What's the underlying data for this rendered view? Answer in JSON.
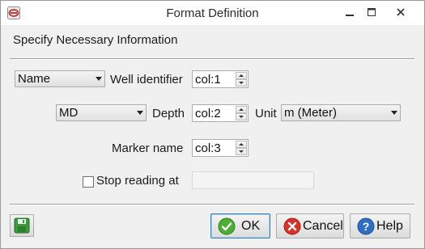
{
  "window": {
    "title": "Format Definition",
    "controls": [
      "minimize-icon",
      "maximize-icon",
      "close-icon"
    ]
  },
  "main": {
    "heading": "Specify Necessary Information",
    "well_identifier": {
      "combo_value": "Name",
      "label": "Well identifier",
      "column_value": "col:1"
    },
    "depth": {
      "combo_value": "MD",
      "label": "Depth",
      "column_value": "col:2",
      "unit_label": "Unit",
      "unit_value": "m (Meter)"
    },
    "marker_name": {
      "label": "Marker name",
      "column_value": "col:3"
    },
    "stop_reading": {
      "label": "Stop reading at",
      "checked": false,
      "value": ""
    }
  },
  "footer": {
    "ok_label": "OK",
    "cancel_label": "Cancel",
    "help_label": "Help"
  },
  "colors": {
    "ok_icon": "#4cae34",
    "cancel_icon": "#d9322a",
    "help_icon": "#2f6fc3",
    "save_icon": "#3c9a3c"
  }
}
